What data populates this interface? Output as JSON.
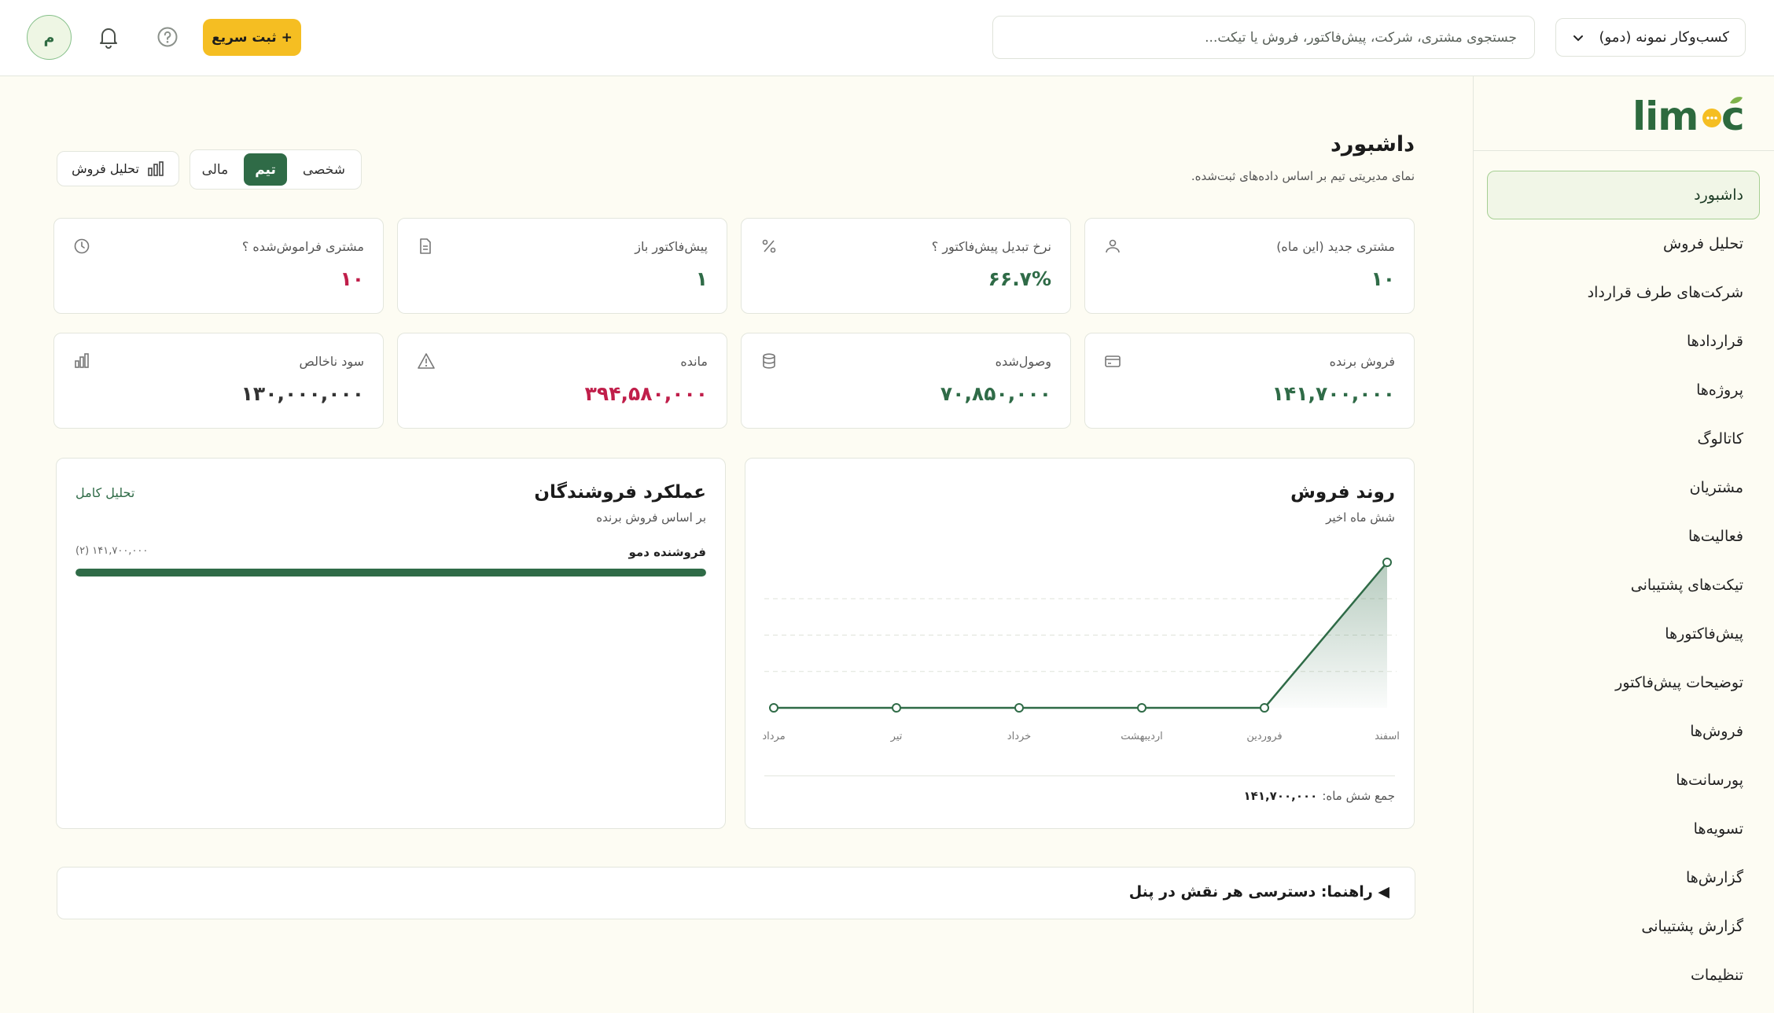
{
  "header": {
    "business": "کسب‌وکار نمونه (دمو)",
    "search_placeholder": "جستجوی مشتری، شرکت، پیش‌فاکتور، فروش یا تیکت...",
    "quick_add": "+ ثبت سریع",
    "avatar": "م"
  },
  "sidebar": {
    "logo": "limoc",
    "items": [
      {
        "label": "داشبورد",
        "active": true
      },
      {
        "label": "تحلیل فروش"
      },
      {
        "label": "شرکت‌های طرف قرارداد"
      },
      {
        "label": "قراردادها"
      },
      {
        "label": "پروژه‌ها"
      },
      {
        "label": "کاتالوگ"
      },
      {
        "label": "مشتریان"
      },
      {
        "label": "فعالیت‌ها"
      },
      {
        "label": "تیکت‌های پشتیبانی"
      },
      {
        "label": "پیش‌فاکتورها"
      },
      {
        "label": "توضیحات پیش‌فاکتور"
      },
      {
        "label": "فروش‌ها"
      },
      {
        "label": "پورسانت‌ها"
      },
      {
        "label": "تسویه‌ها"
      },
      {
        "label": "گزارش‌ها"
      },
      {
        "label": "گزارش پشتیبانی"
      },
      {
        "label": "تنظیمات"
      }
    ]
  },
  "page": {
    "title": "داشبورد",
    "subtitle": "نمای مدیریتی تیم بر اساس داده‌های ثبت‌شده.",
    "tabs": [
      "شخصی",
      "تیم",
      "مالی"
    ],
    "active_tab": "تیم",
    "analysis_button": "تحلیل فروش"
  },
  "kpis": [
    {
      "label": "مشتری جدید (این ماه)",
      "value": "۱۰",
      "icon": "users-icon",
      "color": "#2f6b47"
    },
    {
      "label": "نرخ تبدیل پیش‌فاکتور ؟",
      "value": "۶۶.۷%",
      "icon": "percent-icon",
      "color": "#2f6b47"
    },
    {
      "label": "پیش‌فاکتور باز",
      "value": "۱",
      "icon": "document-icon",
      "color": "#2f6b47"
    },
    {
      "label": "مشتری فراموش‌شده ؟",
      "value": "۱۰",
      "icon": "clock-icon",
      "color": "#c01e4a"
    },
    {
      "label": "فروش برنده",
      "value": "۱۴۱,۷۰۰,۰۰۰",
      "icon": "card-icon",
      "color": "#2f6b47"
    },
    {
      "label": "وصول‌شده",
      "value": "۷۰,۸۵۰,۰۰۰",
      "icon": "database-icon",
      "color": "#2f6b47"
    },
    {
      "label": "مانده",
      "value": "۳۹۴,۵۸۰,۰۰۰",
      "icon": "warning-icon",
      "color": "#c01e4a"
    },
    {
      "label": "سود ناخالص",
      "value": "۱۳۰,۰۰۰,۰۰۰",
      "icon": "bar-chart-icon",
      "color": "#333333"
    }
  ],
  "sales_trend": {
    "title": "روند فروش",
    "subtitle": "شش ماه اخیر",
    "total_label": "جمع شش ماه:",
    "total_value": "۱۴۱,۷۰۰,۰۰۰"
  },
  "chart_data": {
    "type": "area",
    "categories": [
      "مرداد",
      "تیر",
      "خرداد",
      "اردیبهشت",
      "فروردین",
      "اسفند"
    ],
    "values": [
      0,
      0,
      0,
      0,
      0,
      141700000
    ],
    "ylim": [
      0,
      141700000
    ],
    "grid": true,
    "color": "#2f6b47"
  },
  "sellers": {
    "title": "عملکرد فروشندگان",
    "subtitle": "بر اساس فروش برنده",
    "link": "تحلیل کامل",
    "rows": [
      {
        "name": "فروشنده دمو",
        "amount": "۱۴۱,۷۰۰,۰۰۰ (۲)",
        "share": 1.0
      }
    ]
  },
  "guide": {
    "text": "◀ راهنما: دسترسی هر نقش در پنل"
  }
}
